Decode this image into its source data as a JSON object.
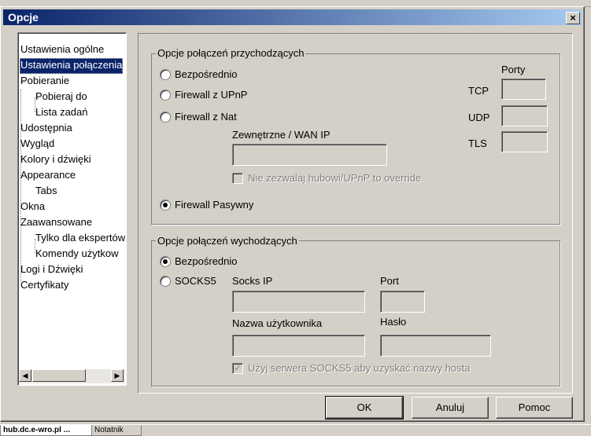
{
  "taskbar": {
    "tab1": "hub.dc.e-wro.pl ...",
    "tab2": "Notatnik"
  },
  "dialog": {
    "title": "Opcje",
    "close_glyph": "×"
  },
  "tree": {
    "items": [
      "Ustawienia ogólne",
      "Ustawienia połączenia",
      "Pobieranie",
      "Pobieraj do",
      "Lista zadań",
      "Udostępnia",
      "Wygląd",
      "Kolory i dźwięki",
      "Appearance",
      "Tabs",
      "Okna",
      "Zaawansowane",
      "Tylko dla ekspertów",
      "Komendy użytkow",
      "Logi i Dźwięki",
      "Certyfikaty"
    ],
    "selected": "Ustawienia połączenia",
    "scroll_left_glyph": "◀",
    "scroll_right_glyph": "▶"
  },
  "incoming": {
    "legend": "Opcje połączeń przychodzących",
    "opt_direct": "Bezpośrednio",
    "opt_upnp": "Firewall z UPnP",
    "opt_nat": "Firewall z Nat",
    "wan_ip_label": "Zewnętrzne / WAN IP",
    "wan_ip_value": "",
    "no_override_label": "Nie zezwalaj hubowi/UPnP to override",
    "opt_passive": "Firewall Pasywny",
    "selected": "Firewall Pasywny",
    "ports_label": "Porty",
    "tcp_label": "TCP",
    "udp_label": "UDP",
    "tls_label": "TLS",
    "tcp_value": "",
    "udp_value": "",
    "tls_value": ""
  },
  "outgoing": {
    "legend": "Opcje połączeń wychodzących",
    "opt_direct": "Bezpośrednio",
    "opt_socks": "SOCKS5",
    "selected": "Bezpośrednio",
    "socks_ip_label": "Socks IP",
    "port_label": "Port",
    "username_label": "Nazwa użytkownika",
    "password_label": "Hasło",
    "socks_ip_value": "",
    "port_value": "",
    "username_value": "",
    "password_value": "",
    "resolve_label": "Użyj serwera SOCKS5 aby uzyskać nazwy hosta",
    "resolve_checked": true
  },
  "buttons": {
    "ok": "OK",
    "cancel": "Anuluj",
    "help": "Pomoc"
  }
}
